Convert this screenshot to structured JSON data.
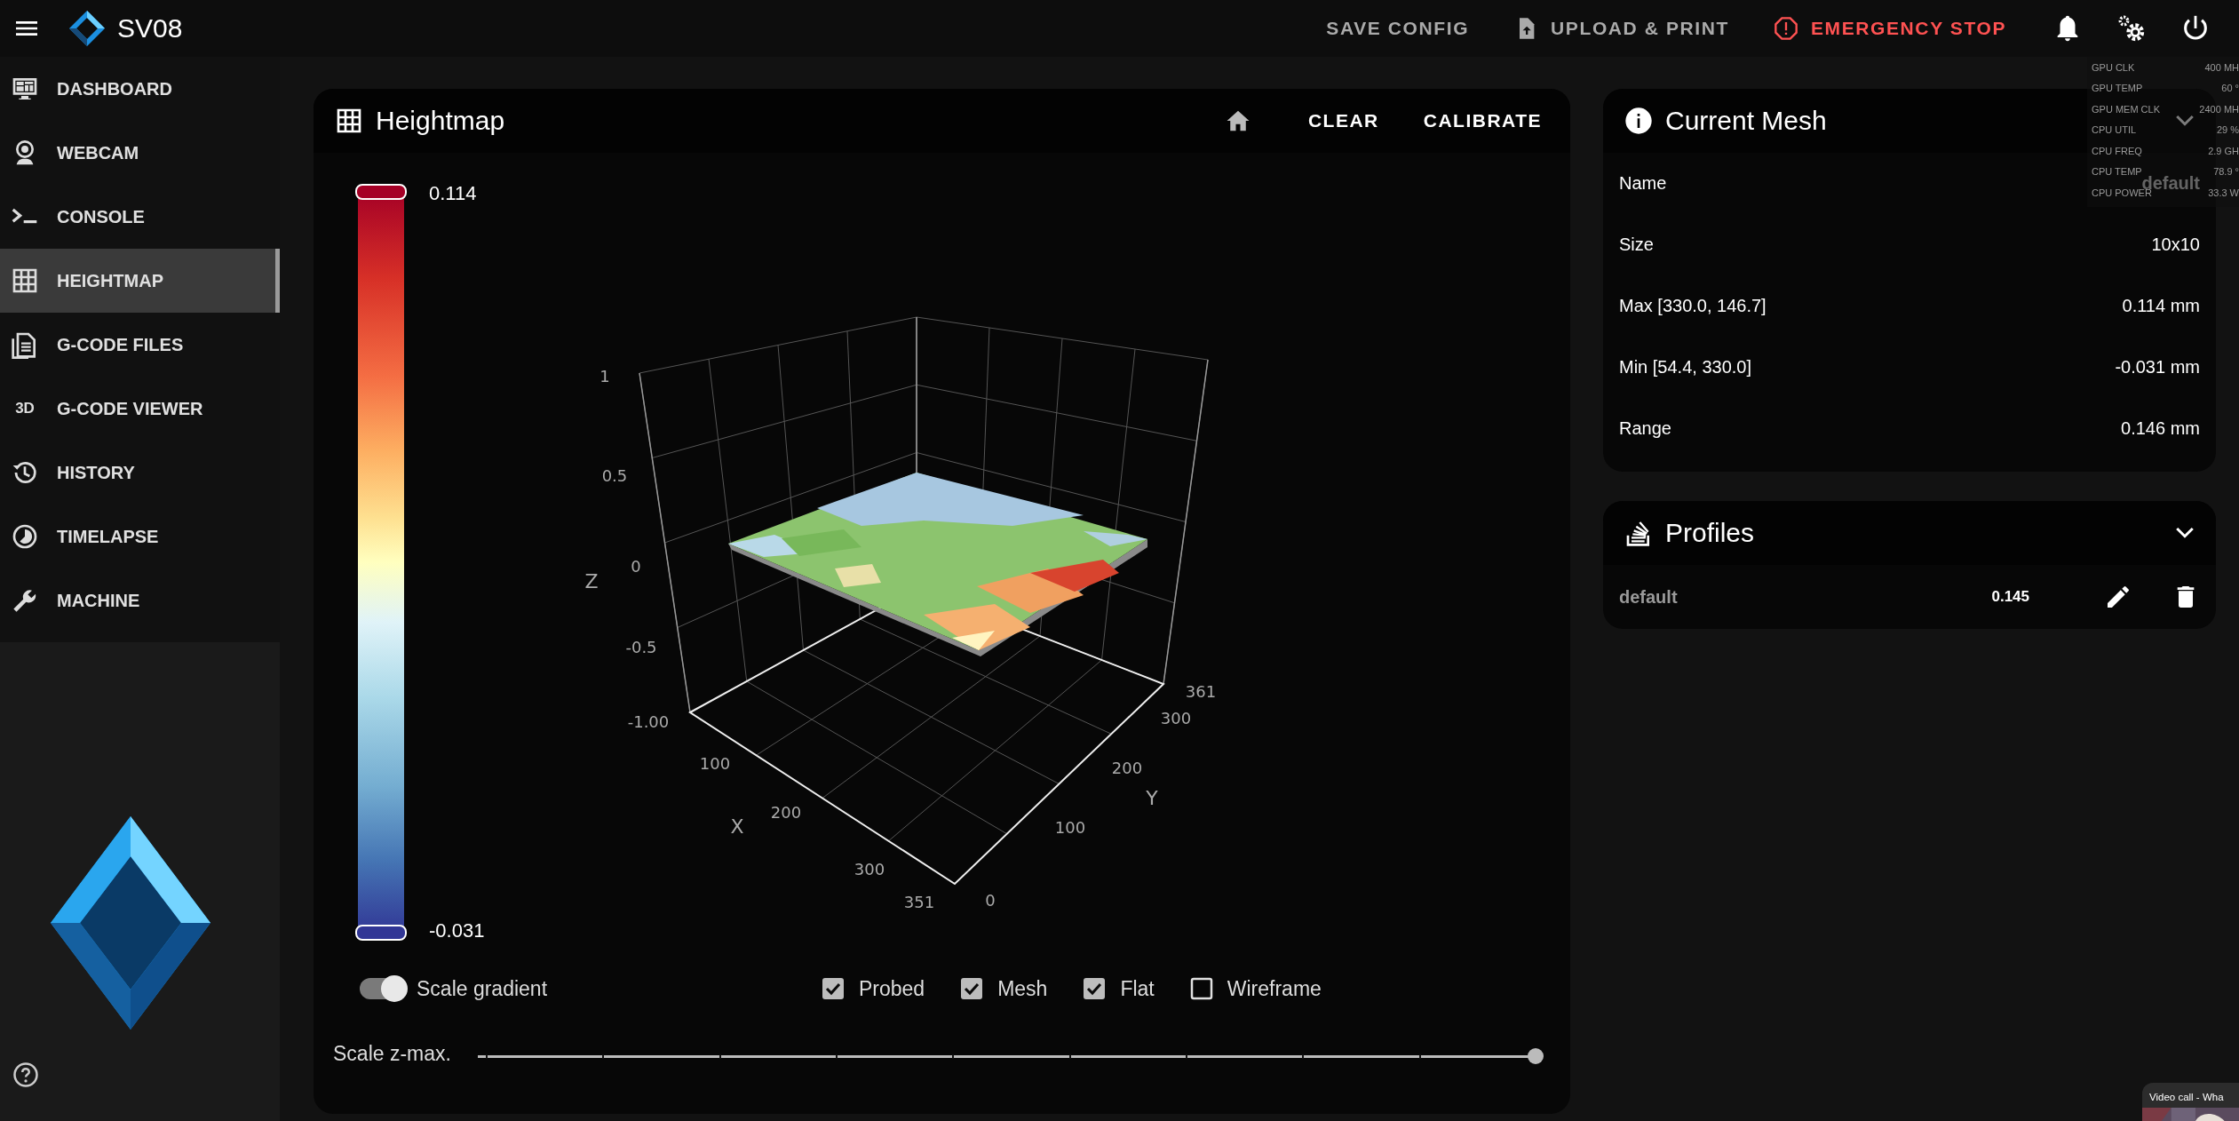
{
  "app_bar": {
    "title": "SV08",
    "actions": [
      {
        "kind": "text",
        "label": "SAVE CONFIG"
      },
      {
        "kind": "upload",
        "label": "UPLOAD & PRINT"
      },
      {
        "kind": "stop",
        "label": "EMERGENCY STOP"
      }
    ]
  },
  "sidebar": {
    "items": [
      {
        "label": "DASHBOARD",
        "selected": false
      },
      {
        "label": "WEBCAM",
        "selected": false
      },
      {
        "label": "CONSOLE",
        "selected": false
      },
      {
        "label": "HEIGHTMAP",
        "selected": true
      },
      {
        "label": "G-CODE FILES",
        "selected": false
      },
      {
        "label": "G-CODE VIEWER",
        "selected": false,
        "icon_text": "3D"
      },
      {
        "label": "HISTORY",
        "selected": false
      },
      {
        "label": "TIMELAPSE",
        "selected": false
      },
      {
        "label": "MACHINE",
        "selected": false
      }
    ]
  },
  "heightmap": {
    "title": "Heightmap",
    "actions": [
      "CLEAR",
      "CALIBRATE"
    ],
    "scale": {
      "max": "0.114",
      "min": "-0.031"
    },
    "plot": {
      "axis_titles": [
        "Z",
        "X",
        "Y"
      ],
      "z_ticks": [
        "1",
        "0.5",
        "0",
        "-0.5",
        "-1.00"
      ],
      "x_ticks": [
        "100",
        "200",
        "300",
        "351"
      ],
      "y_ticks": [
        "0",
        "100",
        "200",
        "300",
        "361"
      ]
    },
    "toggle": {
      "label": "Scale gradient",
      "on": true
    },
    "checkboxes": [
      {
        "label": "Probed",
        "checked": true
      },
      {
        "label": "Mesh",
        "checked": true
      },
      {
        "label": "Flat",
        "checked": true
      },
      {
        "label": "Wireframe",
        "checked": false
      }
    ],
    "slider": {
      "label": "Scale z-max.",
      "level": 1
    }
  },
  "current_mesh": {
    "title": "Current Mesh",
    "rows": [
      {
        "label": "Name",
        "value": "default"
      },
      {
        "label": "Size",
        "value": "10x10"
      },
      {
        "label": "Max [330.0, 146.7]",
        "value": "0.114 mm"
      },
      {
        "label": "Min [54.4, 330.0]",
        "value": "-0.031 mm"
      },
      {
        "label": "Range",
        "value": "0.146 mm"
      }
    ]
  },
  "profiles": {
    "title": "Profiles",
    "rows": [
      {
        "name": "default",
        "value": "0.145"
      }
    ]
  },
  "stats_overlay": {
    "rows": [
      {
        "label": "GPU CLK",
        "value": "400 MH"
      },
      {
        "label": "GPU TEMP",
        "value": "60 °"
      },
      {
        "label": "GPU MEM CLK",
        "value": "2400 MH"
      },
      {
        "label": "CPU UTIL",
        "value": "29 %"
      },
      {
        "label": "CPU FREQ",
        "value": "2.9 GH"
      },
      {
        "label": "CPU TEMP",
        "value": "78.9 °"
      },
      {
        "label": "CPU POWER",
        "value": "33.3 W"
      }
    ]
  },
  "video_call": {
    "title": "Video call - Wha"
  }
}
